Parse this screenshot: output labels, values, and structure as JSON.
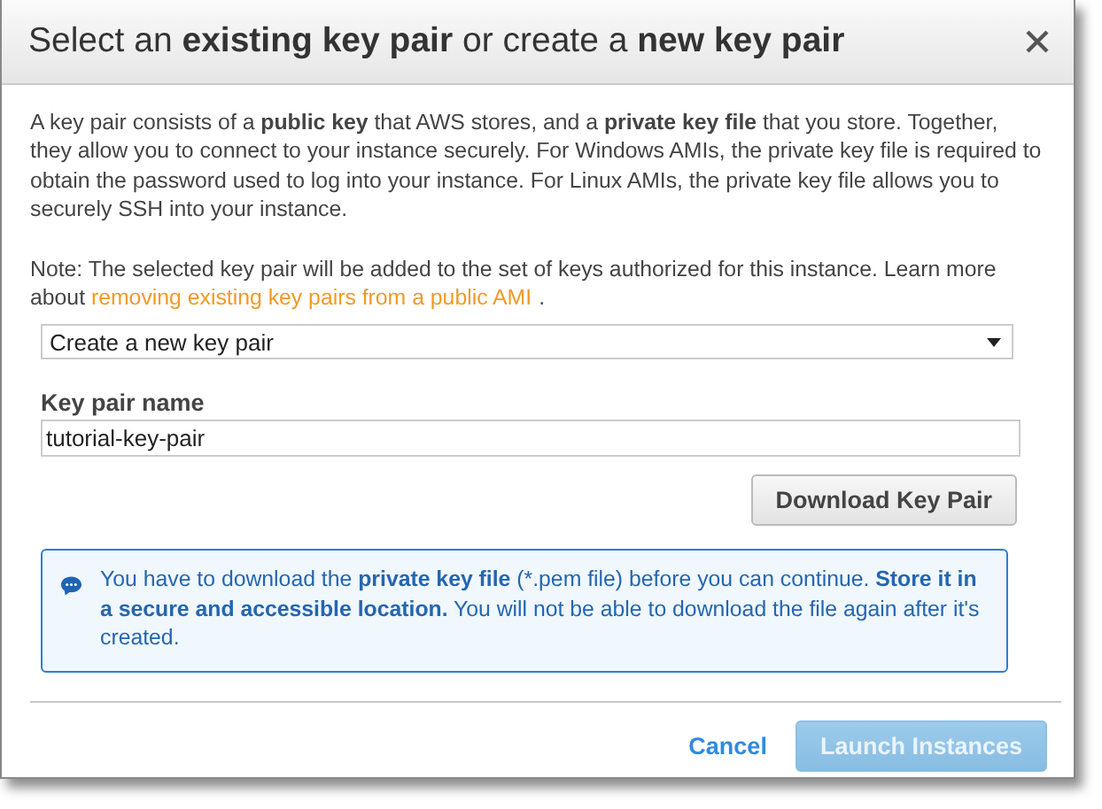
{
  "dialog": {
    "title": "Select an **existing key pair** or create a **new key pair**",
    "description": "A key pair consists of a **public key** that AWS stores, and a **private key file** that you store. Together, they allow you to connect to your instance securely. For Windows AMIs, the private key file is required to obtain the password used to log into your instance. For Linux AMIs, the private key file allows you to securely SSH into your instance.",
    "note": {
      "text": "Note: The selected key pair will be added to the set of keys authorized for this instance. Learn more about",
      "link": "removing existing key pairs from a public AMI",
      "end": "."
    },
    "key_pair_action": {
      "value": "Create a new key pair"
    },
    "key_pair_name": {
      "label": "Key pair name",
      "value": "tutorial-key-pair"
    },
    "download_button": {
      "label": "Download Key Pair"
    },
    "info": "You have to download the **private key file** (*.pem file) before you can continue. **Store it in a secure and accessible location.** You will not be able to download the file again after it's created.",
    "footer": {
      "cancel": {
        "label": "Cancel"
      },
      "launch": {
        "label": "Launch Instances",
        "disabled": true
      }
    }
  }
}
